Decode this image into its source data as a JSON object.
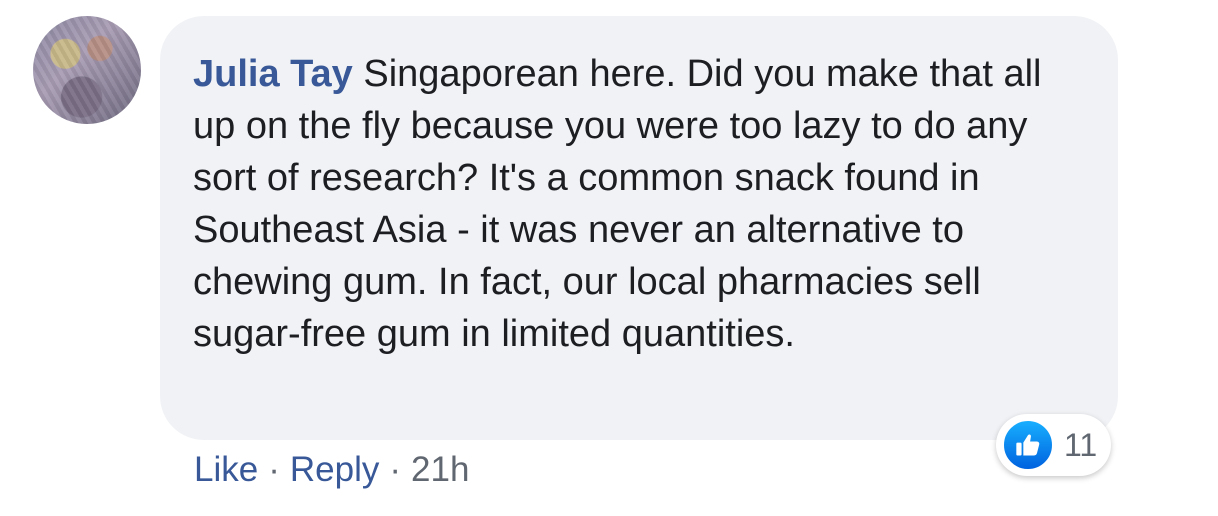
{
  "comment": {
    "author": "Julia Tay",
    "text": "Singaporean here. Did you make that all up on the fly because you were too lazy to do any sort of research? It's a common snack found in Southeast Asia - it was never an alternative to chewing gum. In fact, our local pharmacies sell sugar-free gum in limited quantities."
  },
  "actions": {
    "like_label": "Like",
    "separator": "·",
    "reply_label": "Reply",
    "timestamp": "21h"
  },
  "reactions": {
    "icon": "thumbs-up-icon",
    "count": "11",
    "color": "#1877f2"
  },
  "colors": {
    "bubble": "#f0f2f5",
    "author": "#385898",
    "text": "#1c1e21",
    "meta": "#606770"
  }
}
